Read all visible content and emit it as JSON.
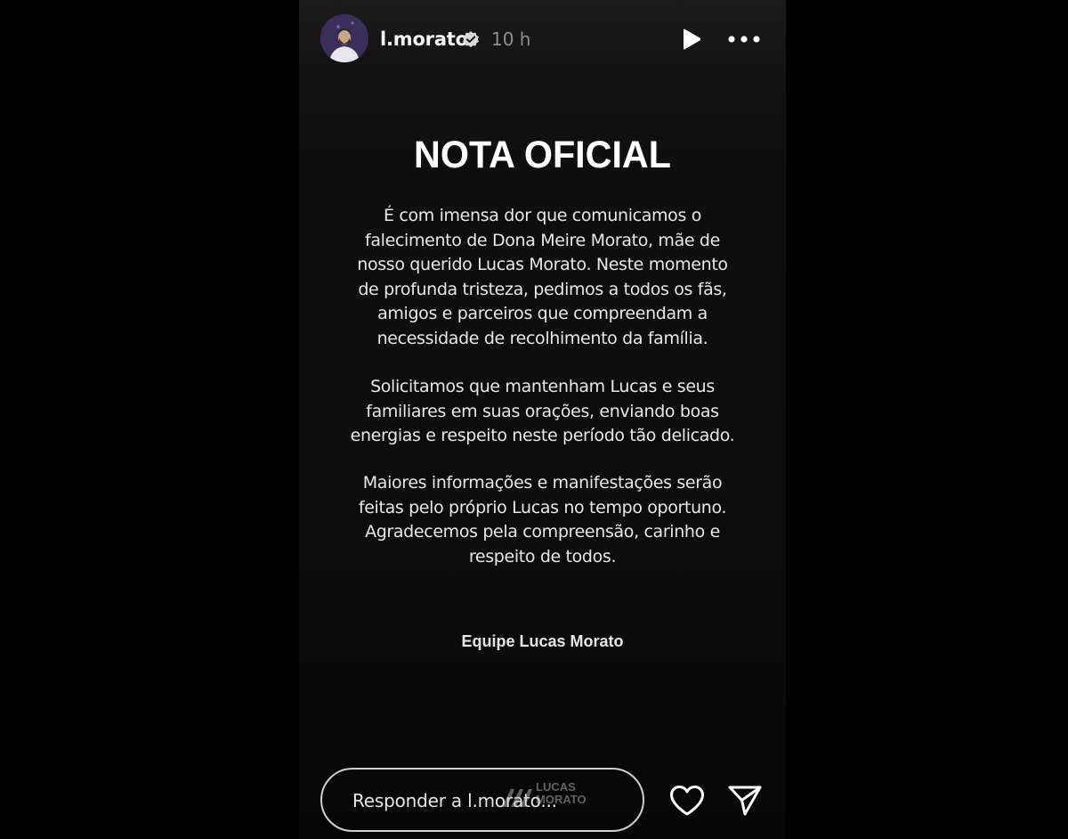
{
  "header": {
    "username": "l.morato",
    "time_ago": "10 h",
    "icons": {
      "avatar": "profile-avatar",
      "verified": "verified-badge-icon",
      "play": "play-icon",
      "more": "more-options-icon"
    }
  },
  "story": {
    "title": "NOTA OFICIAL",
    "paragraph_1": "É com imensa dor que comunicamos o\nfalecimento de Dona Meire Morato, mãe de\nnosso querido Lucas Morato. Neste momento\nde profunda tristeza, pedimos a todos os fãs,\namigos e parceiros que compreendam a\nnecessidade de recolhimento da família.",
    "paragraph_2": "Solicitamos que mantenham Lucas e seus\nfamiliares em suas orações, enviando boas\nenergias e respeito neste período tão delicado.",
    "paragraph_3": "Maiores informações e manifestações serão\nfeitas pelo próprio Lucas no tempo oportuno.\nAgradecemos pela compreensão, carinho e\nrespeito de todos.",
    "signature": "Equipe Lucas Morato"
  },
  "footer": {
    "reply_placeholder": "Responder a l.morato...",
    "watermark": "LUCAS\nMORATO",
    "icons": {
      "like": "heart-icon",
      "share": "send-icon"
    }
  },
  "colors": {
    "page_background": "#000000",
    "story_background": "#0d0d0d",
    "text_primary": "#ffffff",
    "text_secondary": "#8f8f8f",
    "reply_border": "#d0d0d0"
  }
}
